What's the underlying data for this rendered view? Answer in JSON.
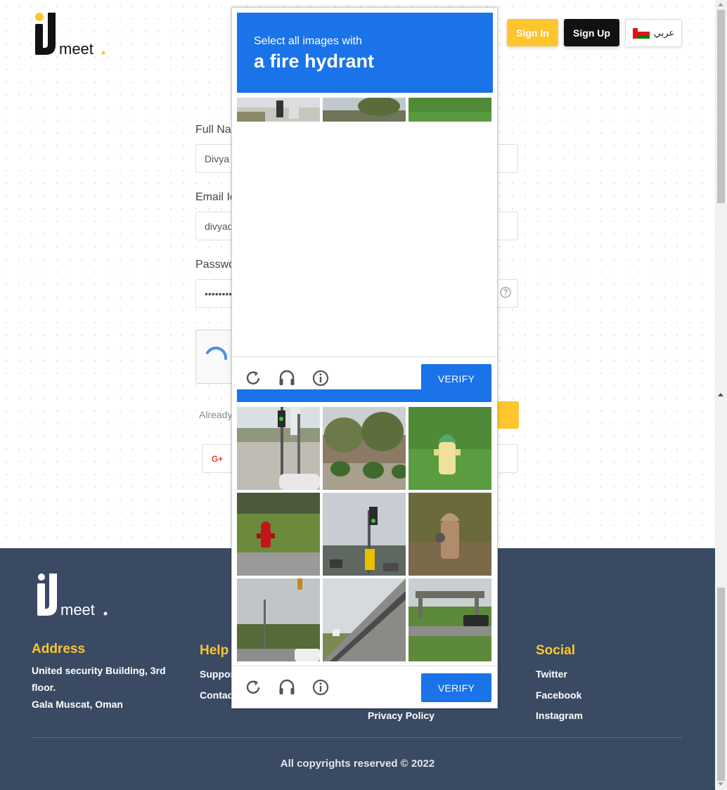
{
  "header": {
    "logo_text": "meet",
    "signin_label": "Sign In",
    "signup_label": "Sign Up",
    "language_label": "عربي"
  },
  "form": {
    "fullname_label": "Full Na",
    "fullname_value": "Divya",
    "email_label": "Email Id",
    "email_value": "divyad",
    "password_label": "Passwo",
    "password_value": "•••••••••",
    "already_text": "Already",
    "google_label": "G+"
  },
  "captcha": {
    "instruction": "Select all images with",
    "target": "a fire hydrant",
    "verify_label": "VERIFY",
    "verify_label_2": "VERIFY"
  },
  "footer": {
    "logo_text": "meet",
    "address_heading": "Address",
    "address_line1": "United security Building, 3rd",
    "address_line2": "floor.",
    "address_line3": "Gala Muscat, Oman",
    "help_heading": "Help",
    "help_link1": "Suppor",
    "help_link2": "Contac",
    "privacy_link": "Privacy Policy",
    "social_heading": "Social",
    "social_twitter": "Twitter",
    "social_facebook": "Facebook",
    "social_instagram": "Instagram",
    "copyright": "All copyrights reserved © 2022"
  },
  "colors": {
    "brand_yellow": "#fec52e",
    "footer_bg": "#3a4a63",
    "captcha_blue": "#1a73e8"
  }
}
